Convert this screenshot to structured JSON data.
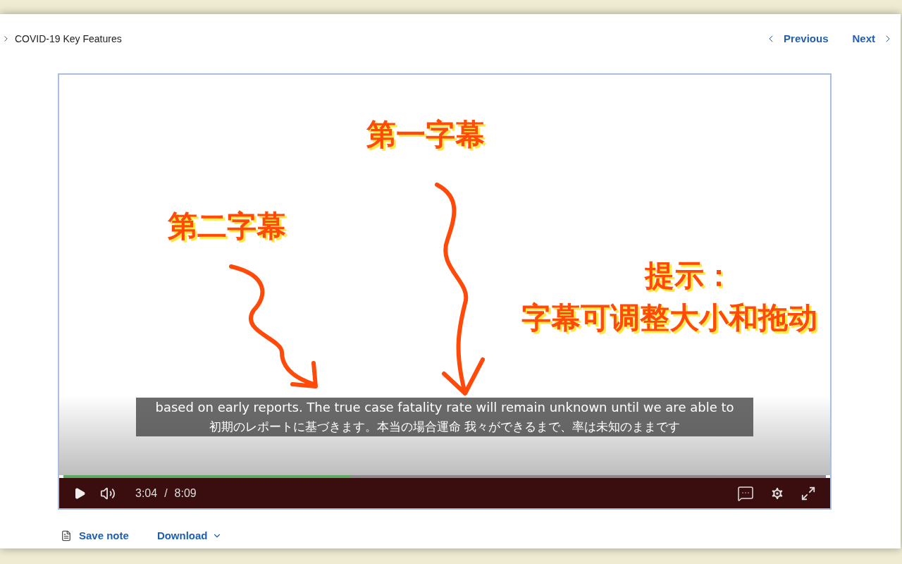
{
  "breadcrumb": {
    "title": "COVID-19 Key Features"
  },
  "nav": {
    "previous": "Previous",
    "next": "Next"
  },
  "player": {
    "captions": [
      "based on early reports. The true case fatality rate will remain unknown until we are able to",
      "初期のレポートに基づきます。本当の場合運命 我々ができるまで、率は未知のままです"
    ],
    "progress": {
      "level": 0.376
    },
    "current_time": "3:04",
    "separator": "/",
    "duration": "8:09"
  },
  "annotations": [
    {
      "text": "第一字幕"
    },
    {
      "text": "第二字幕"
    },
    {
      "text": "提示："
    },
    {
      "text": "字幕可调整大小和拖动"
    }
  ],
  "actions": {
    "save_note": "Save note",
    "download": "Download"
  }
}
